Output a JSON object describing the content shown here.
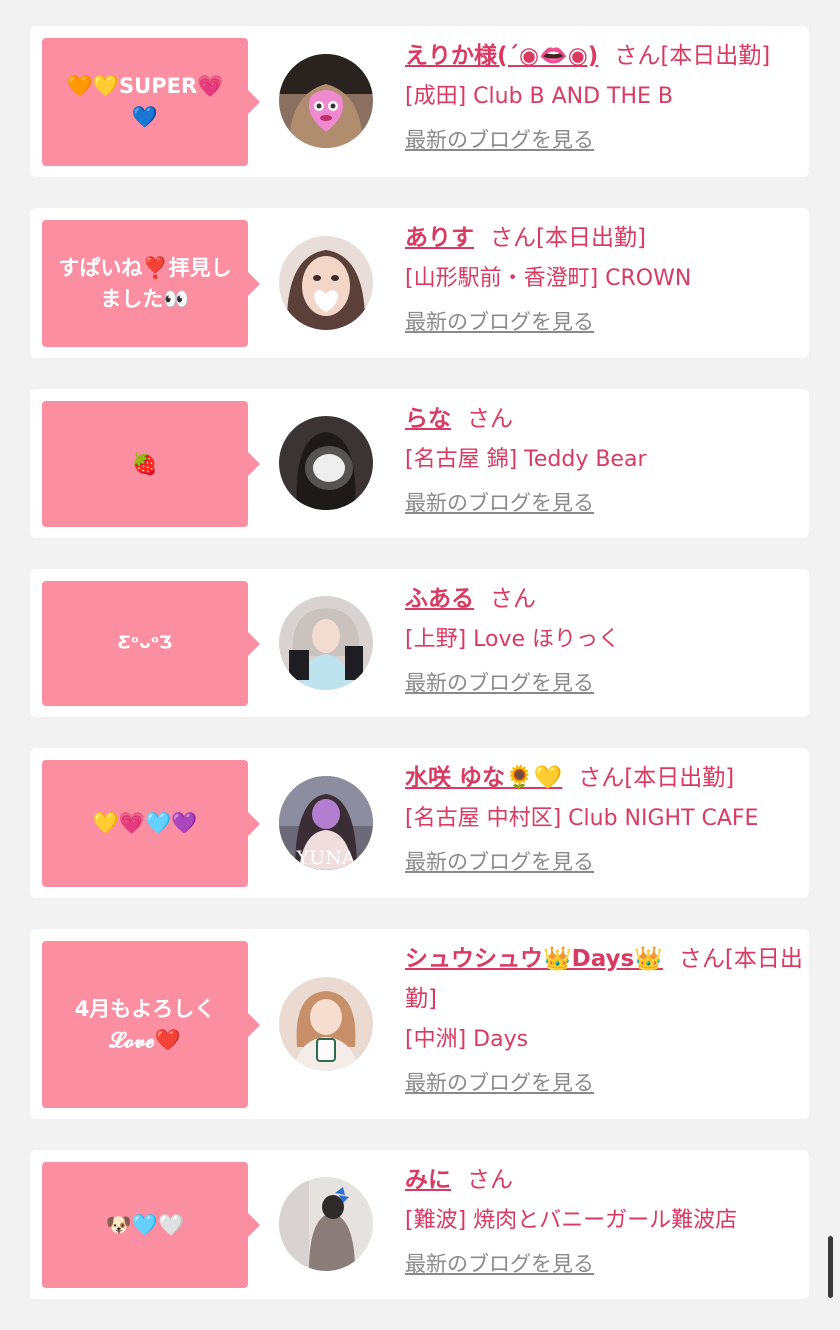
{
  "colors": {
    "accent": "#d93a62",
    "bubble": "#fb8fa1",
    "link": "#8a8a8a",
    "background": "#f2f2f2"
  },
  "items": [
    {
      "bubble": "🧡💛SUPER💗💙",
      "name": "えりか様(´◉👄◉)",
      "san": "さん[本日出勤]",
      "shop": "[成田] Club B AND THE B",
      "blog": "最新のブログを見る",
      "avatar_desc": "avatar-pink-heart-mask"
    },
    {
      "bubble": "すぱいね❣️拝見しました👀",
      "name": "ありす",
      "san": "さん[本日出勤]",
      "shop": "[山形駅前・香澄町] CROWN",
      "blog": "最新のブログを見る",
      "avatar_desc": "avatar-heart-mask"
    },
    {
      "bubble": "🍓",
      "name": "らな",
      "san": "さん",
      "shop": "[名古屋 錦] Teddy Bear",
      "blog": "最新のブログを見る",
      "avatar_desc": "avatar-blurred"
    },
    {
      "bubble": "ƸᵒᴗᵒƷ",
      "name": "ふある",
      "san": "さん",
      "shop": "[上野] Love ほりっく",
      "blog": "最新のブログを見る",
      "avatar_desc": "avatar-blue-dress"
    },
    {
      "bubble": "💛💗🩵💜",
      "name": "水咲 ゆな🌻💛",
      "san": "さん[本日出勤]",
      "shop": "[名古屋 中村区] Club NIGHT CAFE",
      "blog": "最新のブログを見る",
      "avatar_desc": "avatar-yuna",
      "avatar_text": "YUNA"
    },
    {
      "bubble": "4月もよろしく 𝓛𝓸𝓿𝓮❤️",
      "name": "シュウシュウ👑Days👑",
      "san": "さん[本日出勤]",
      "shop": "[中洲] Days",
      "blog": "最新のブログを見る",
      "avatar_desc": "avatar-cup"
    },
    {
      "bubble": "🐶🩵🤍",
      "name": "みに",
      "san": "さん",
      "shop": "[難波] 焼肉とバニーガール難波店",
      "blog": "最新のブログを見る",
      "avatar_desc": "avatar-bow"
    }
  ]
}
